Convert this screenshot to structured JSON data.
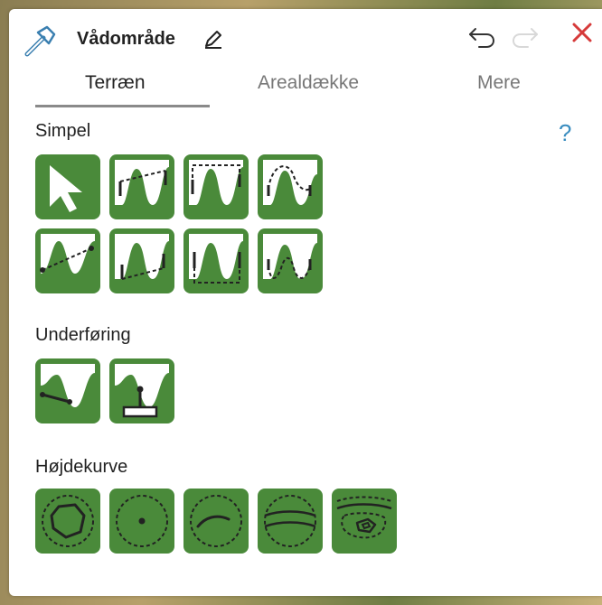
{
  "header": {
    "title": "Vådområde",
    "icons": [
      "hammer-icon",
      "pencil-icon",
      "undo-icon",
      "redo-icon",
      "close-icon"
    ],
    "close_color": "#d63a3a"
  },
  "tabs": [
    {
      "label": "Terræn",
      "active": true
    },
    {
      "label": "Arealdække",
      "active": false
    },
    {
      "label": "Mere",
      "active": false
    }
  ],
  "sections": {
    "simple": {
      "label": "Simpel",
      "help": "?",
      "tools": [
        "select-arrow-icon",
        "profile-slope-icon",
        "profile-flat-top-icon",
        "profile-dashed-arch-icon",
        "profile-diagonal-icon",
        "profile-step-icon",
        "profile-flat-bottom-icon",
        "profile-dashed-hill-icon"
      ]
    },
    "underpass": {
      "label": "Underføring",
      "tools": [
        "underpass-line-icon",
        "underpass-pipe-icon"
      ]
    },
    "contour": {
      "label": "Højdekurve",
      "tools": [
        "contour-polygon-icon",
        "contour-point-icon",
        "contour-line-icon",
        "contour-parallel-icon",
        "contour-nested-icon"
      ]
    }
  },
  "colors": {
    "tool_green": "#4a8a3a",
    "accent_blue": "#3a8dc0"
  }
}
